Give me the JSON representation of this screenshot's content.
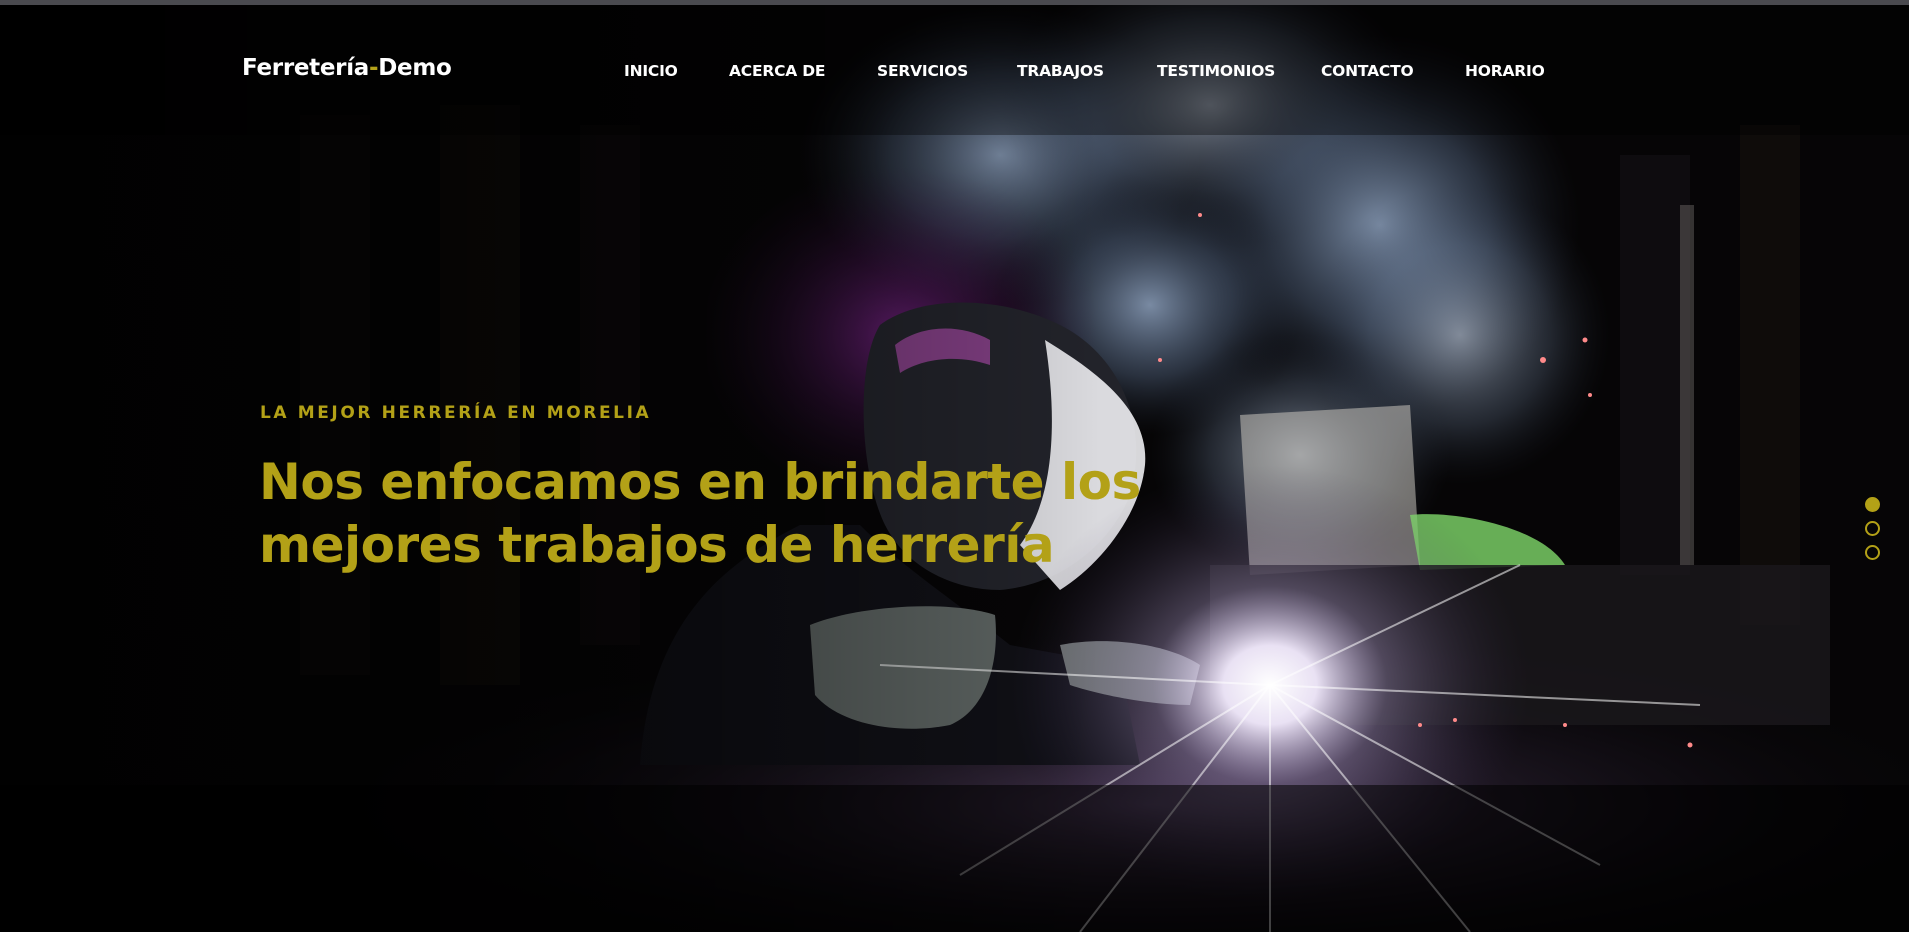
{
  "brand": {
    "name_part1": "Ferretería",
    "separator": "-",
    "name_part2": "Demo"
  },
  "nav": {
    "items": [
      {
        "label": "INICIO"
      },
      {
        "label": "ACERCA DE"
      },
      {
        "label": "SERVICIOS"
      },
      {
        "label": "TRABAJOS"
      },
      {
        "label": "TESTIMONIOS"
      },
      {
        "label": "CONTACTO"
      },
      {
        "label": "HORARIO"
      }
    ]
  },
  "hero": {
    "kicker": "LA MEJOR HERRERÍA EN MORELIA",
    "headline_line1": "Nos enfocamos en brindarte los",
    "headline_line2": "mejores trabajos de herrería",
    "background_image": "welder-sparks-photo"
  },
  "slider": {
    "slide_count": 3,
    "active_slide": 1
  },
  "colors": {
    "accent": "#b3a117",
    "nav_text": "#ffffff",
    "background": "#050506"
  }
}
